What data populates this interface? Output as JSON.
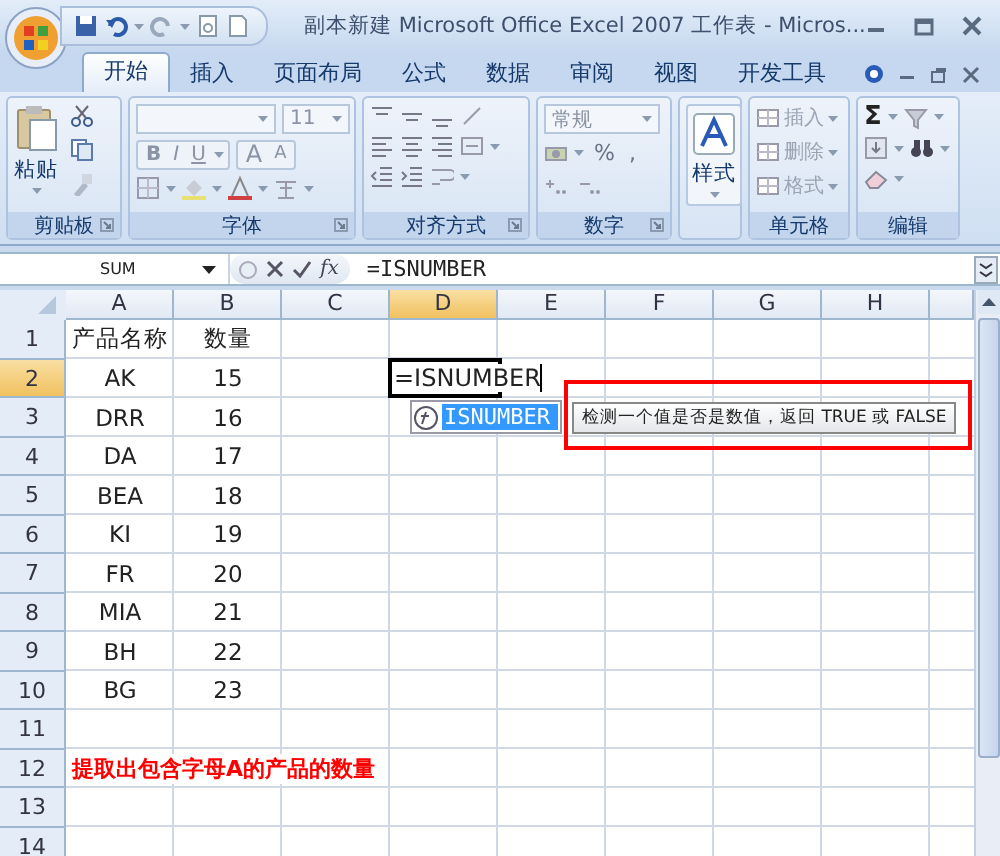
{
  "window": {
    "title": "副本新建 Microsoft Office Excel 2007 工作表 - Micros..."
  },
  "tabs": [
    {
      "label": "开始",
      "selected": true
    },
    {
      "label": "插入",
      "selected": false
    },
    {
      "label": "页面布局",
      "selected": false
    },
    {
      "label": "公式",
      "selected": false
    },
    {
      "label": "数据",
      "selected": false
    },
    {
      "label": "审阅",
      "selected": false
    },
    {
      "label": "视图",
      "selected": false
    },
    {
      "label": "开发工具",
      "selected": false
    }
  ],
  "ribbon": {
    "groups": [
      {
        "kind": "clipboard",
        "label": "剪贴板",
        "launcher": true,
        "paste": "粘贴"
      },
      {
        "kind": "font",
        "label": "字体",
        "launcher": true,
        "font_size": "11",
        "styles": [
          "B",
          "I",
          "U"
        ],
        "size_buttons": [
          "A",
          "A"
        ]
      },
      {
        "kind": "alignment",
        "label": "对齐方式",
        "launcher": true
      },
      {
        "kind": "number",
        "label": "数字",
        "launcher": true,
        "format": "常规",
        "symbols": [
          "%",
          ","
        ]
      },
      {
        "kind": "styles",
        "button": "样式"
      },
      {
        "kind": "cells",
        "label": "单元格",
        "launcher": false,
        "buttons": [
          "插入",
          "删除",
          "格式"
        ]
      },
      {
        "kind": "editing",
        "label": "编辑",
        "launcher": false,
        "sum": "Σ"
      }
    ]
  },
  "formula_bar": {
    "name_box": "SUM",
    "function_label": "fx",
    "formula": "=ISNUMBER"
  },
  "sheet": {
    "columns": [
      {
        "label": "A",
        "selected": false
      },
      {
        "label": "B",
        "selected": false
      },
      {
        "label": "C",
        "selected": false
      },
      {
        "label": "D",
        "selected": true
      },
      {
        "label": "E",
        "selected": false
      },
      {
        "label": "F",
        "selected": false
      },
      {
        "label": "G",
        "selected": false
      },
      {
        "label": "H",
        "selected": false
      }
    ],
    "rows": [
      {
        "label": "1",
        "selected": false,
        "cells": [
          "产品名称",
          "数量"
        ]
      },
      {
        "label": "2",
        "selected": true,
        "cells": [
          "AK",
          "15"
        ]
      },
      {
        "label": "3",
        "selected": false,
        "cells": [
          "DRR",
          "16"
        ]
      },
      {
        "label": "4",
        "selected": false,
        "cells": [
          "DA",
          "17"
        ]
      },
      {
        "label": "5",
        "selected": false,
        "cells": [
          "BEA",
          "18"
        ]
      },
      {
        "label": "6",
        "selected": false,
        "cells": [
          "KI",
          "19"
        ]
      },
      {
        "label": "7",
        "selected": false,
        "cells": [
          "FR",
          "20"
        ]
      },
      {
        "label": "8",
        "selected": false,
        "cells": [
          "MIA",
          "21"
        ]
      },
      {
        "label": "9",
        "selected": false,
        "cells": [
          "BH",
          "22"
        ]
      },
      {
        "label": "10",
        "selected": false,
        "cells": [
          "BG",
          "23"
        ]
      },
      {
        "label": "11",
        "selected": false
      },
      {
        "label": "12",
        "selected": false,
        "note": "提取出包含字母A的产品的数量"
      },
      {
        "label": "13",
        "selected": false
      },
      {
        "label": "14",
        "selected": false
      }
    ]
  },
  "editor": {
    "value": "=ISNUMBER"
  },
  "autocomplete": [
    {
      "label": "ISNUMBER",
      "selected": true
    }
  ],
  "tooltip": {
    "text": "检测一个值是否是数值，返回 TRUE 或 FALSE",
    "highlighted": true
  }
}
